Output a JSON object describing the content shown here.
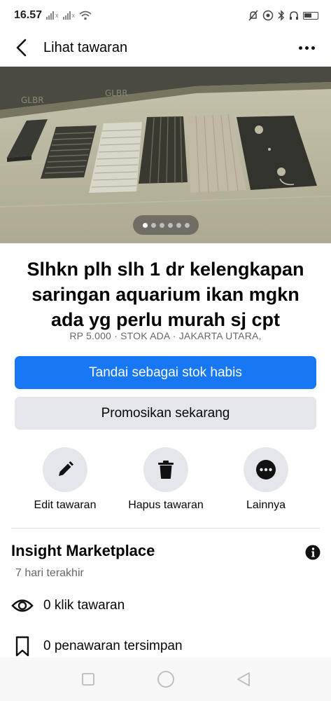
{
  "status_bar": {
    "time": "16.57",
    "signal_1_label": "x",
    "signal_2_label": "x",
    "icons": [
      "signal-icon",
      "signal-icon",
      "wifi-icon",
      "mute-icon",
      "location-icon",
      "bluetooth-icon",
      "headset-icon",
      "battery-icon"
    ]
  },
  "header": {
    "title": "Lihat tawaran",
    "back_icon": "back-arrow-icon",
    "more_icon": "more-options-icon"
  },
  "photo": {
    "pagination": {
      "total": 6,
      "current": 1
    }
  },
  "listing": {
    "title": "Slhkn plh slh 1 dr kelengkapan saringan aquarium ikan mgkn ada yg perlu murah sj cpt",
    "meta": "RP 5.000 · STOK ADA · JAKARTA UTARA,"
  },
  "buttons": {
    "mark_sold_out": "Tandai sebagai stok habis",
    "promote": "Promosikan sekarang"
  },
  "actions": [
    {
      "label": "Edit tawaran",
      "icon": "pencil-icon"
    },
    {
      "label": "Hapus tawaran",
      "icon": "trash-icon"
    },
    {
      "label": "Lainnya",
      "icon": "more-icon"
    }
  ],
  "insight": {
    "title": "Insight Marketplace",
    "subtitle": "7 hari terakhir",
    "stats": [
      {
        "label": "0 klik tawaran",
        "icon": "eye-icon"
      },
      {
        "label": "0 penawaran tersimpan",
        "icon": "bookmark-icon"
      }
    ]
  },
  "nav": {
    "icons": [
      "recents-icon",
      "home-icon",
      "back-icon"
    ]
  },
  "colors": {
    "primary": "#1877f2",
    "secondary_bg": "#e4e6eb",
    "muted_text": "#65676b",
    "text": "#050505"
  }
}
